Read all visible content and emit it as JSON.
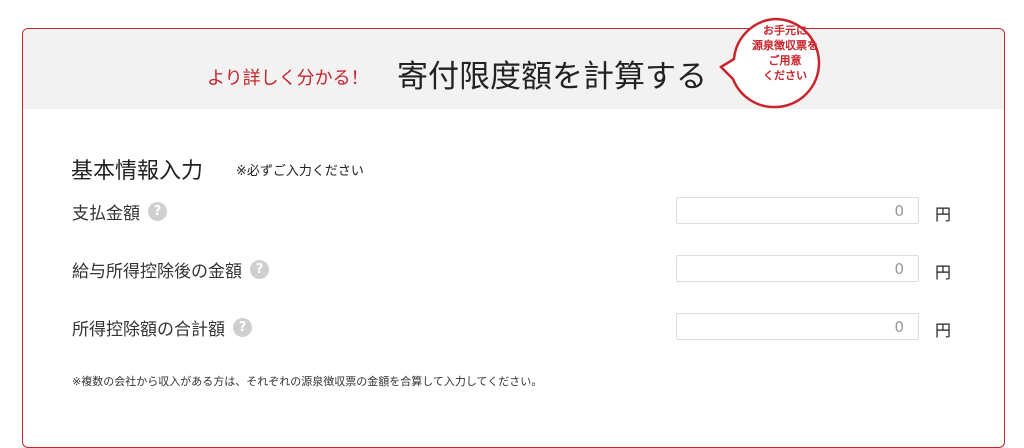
{
  "header": {
    "lead": "より詳しく分かる！",
    "title": "寄付限度額を計算する",
    "bubble_lines": [
      "お手元に",
      "源泉徴収票を",
      "ご用意",
      "ください"
    ]
  },
  "section": {
    "title": "基本情報入力",
    "note": "※必ずご入力ください"
  },
  "rows": [
    {
      "label": "支払金額",
      "value": "0",
      "unit": "円",
      "help_icon": "?"
    },
    {
      "label": "給与所得控除後の金額",
      "value": "0",
      "unit": "円",
      "help_icon": "?"
    },
    {
      "label": "所得控除額の合計額",
      "value": "0",
      "unit": "円",
      "help_icon": "?"
    }
  ],
  "footnote": "※複数の会社から収入がある方は、それぞれの源泉徴収票の金額を合算して入力してください。",
  "colors": {
    "accent": "#c8252c",
    "header_bg": "#f2f2f2",
    "help_icon_bg": "#cfcfcf"
  },
  "icons": {
    "help": "question-mark-circle-icon",
    "callout": "speech-bubble-icon"
  }
}
